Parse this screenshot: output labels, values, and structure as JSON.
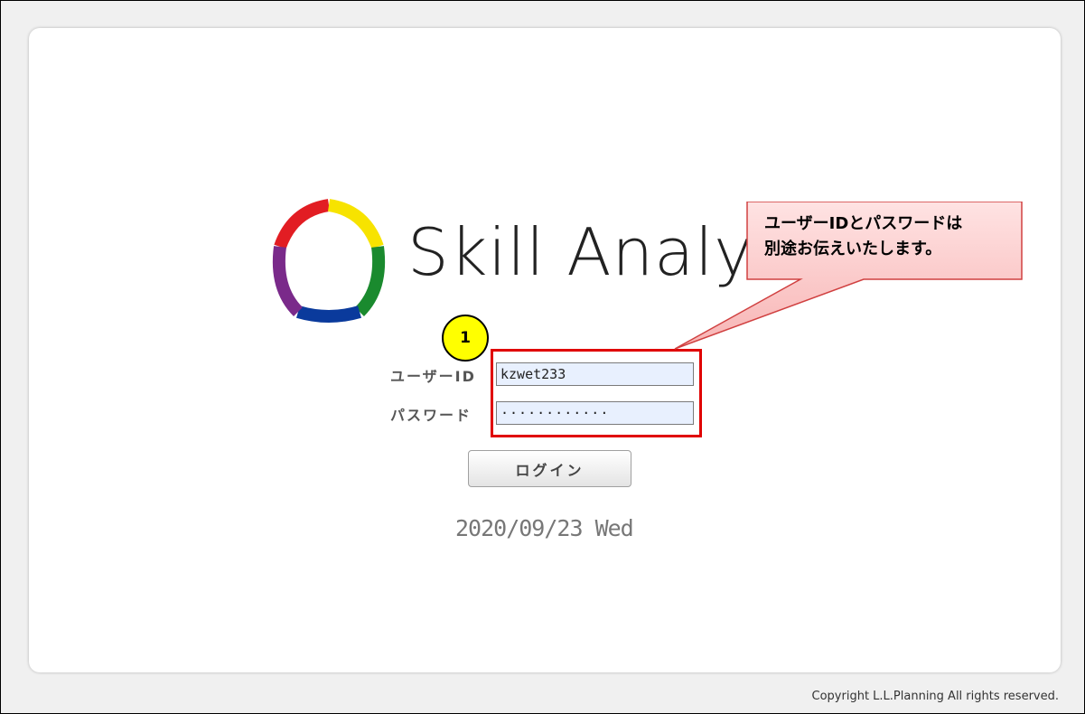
{
  "app": {
    "logo_text": "Skill Analyst",
    "logo_colors": [
      "#e21d23",
      "#f7e300",
      "#1a8a2e",
      "#0a3a9c",
      "#7a2a8a"
    ]
  },
  "login_form": {
    "user_id_label": "ユーザーID",
    "user_id_value": "kzwet233",
    "password_label": "パスワード",
    "password_value": "············",
    "login_button": "ログイン"
  },
  "date_display": "2020/09/23 Wed",
  "annotation": {
    "step_number": "1",
    "callout_text": "ユーザーIDとパスワードは\n別途お伝えいたします。",
    "highlight_color": "#e00000",
    "badge_color": "#ffff00"
  },
  "footer": {
    "copyright": "Copyright L.L.Planning All rights reserved."
  }
}
